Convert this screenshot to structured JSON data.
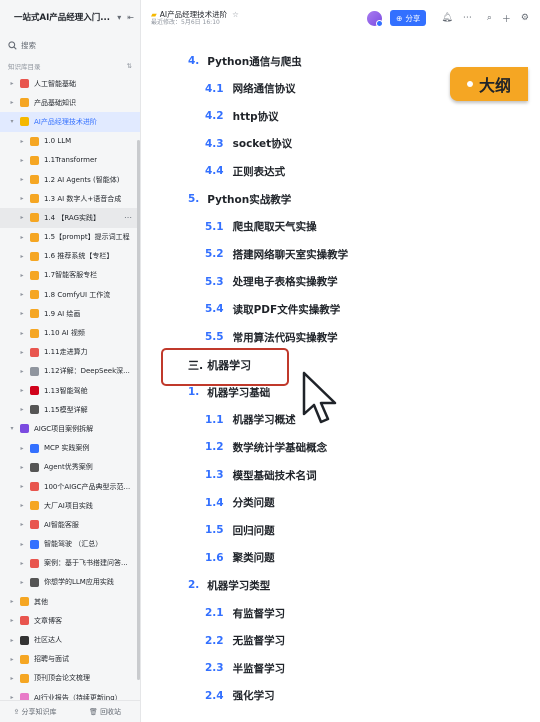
{
  "sidebar": {
    "title": "一站式AI产品经理入门...",
    "search_placeholder": "搜索",
    "section_label": "知识库目录",
    "items": [
      {
        "label": "人工智能基础",
        "depth": 0,
        "color": "#e8554e"
      },
      {
        "label": "产品基础知识",
        "depth": 0,
        "color": "#f5a623"
      },
      {
        "label": "AI产品经理技术进阶",
        "depth": 0,
        "color": "#f5b800",
        "selected": true,
        "open": true
      },
      {
        "label": "1.0 LLM",
        "depth": 1,
        "color": "#f5a623"
      },
      {
        "label": "1.1Transformer",
        "depth": 1,
        "color": "#f5a623"
      },
      {
        "label": "1.2 AI Agents (智能体)",
        "depth": 1,
        "color": "#f5a623"
      },
      {
        "label": "1.3 AI 数字人+语音合成",
        "depth": 1,
        "color": "#f5a623"
      },
      {
        "label": "1.4 【RAG实践】",
        "depth": 1,
        "color": "#f5a623",
        "hover": true
      },
      {
        "label": "1.5【prompt】提示词工程",
        "depth": 1,
        "color": "#f5a623"
      },
      {
        "label": "1.6 推荐系统【专栏】",
        "depth": 1,
        "color": "#f5a623"
      },
      {
        "label": "1.7智能客服专栏",
        "depth": 1,
        "color": "#f5a623"
      },
      {
        "label": "1.8 ComfyUI 工作流",
        "depth": 1,
        "color": "#f5a623"
      },
      {
        "label": "1.9 AI 绘画",
        "depth": 1,
        "color": "#f5a623"
      },
      {
        "label": "1.10 AI 视频",
        "depth": 1,
        "color": "#f5a623"
      },
      {
        "label": "1.11走进算力",
        "depth": 1,
        "color": "#e8554e"
      },
      {
        "label": "1.12详解：DeepSeek深...",
        "depth": 1,
        "color": "#8f959e"
      },
      {
        "label": "1.13智能驾舱",
        "depth": 1,
        "color": "#d0021b"
      },
      {
        "label": "1.15模型详解",
        "depth": 1,
        "color": "#555"
      },
      {
        "label": "AIGC项目案例拆解",
        "depth": 0,
        "color": "#7b4be0",
        "open": true
      },
      {
        "label": "MCP 实践案例",
        "depth": 1,
        "color": "#3370ff"
      },
      {
        "label": "Agent优秀案例",
        "depth": 1,
        "color": "#555"
      },
      {
        "label": "100个AIGC产品典型示范...",
        "depth": 1,
        "color": "#e8554e"
      },
      {
        "label": "大厂AI项目实践",
        "depth": 1,
        "color": "#f5a623"
      },
      {
        "label": "AI智能客服",
        "depth": 1,
        "color": "#e8554e"
      },
      {
        "label": "智能驾驶 （汇总）",
        "depth": 1,
        "color": "#3370ff"
      },
      {
        "label": "案例：基于飞书搭建问答...",
        "depth": 1,
        "color": "#e8554e"
      },
      {
        "label": "你想学的LLM应用实践",
        "depth": 1,
        "color": "#555"
      },
      {
        "label": "其他",
        "depth": 0,
        "color": "#f5a623"
      },
      {
        "label": "文章博客",
        "depth": 0,
        "color": "#e8554e"
      },
      {
        "label": "社区达人",
        "depth": 0,
        "color": "#333"
      },
      {
        "label": "招聘与面试",
        "depth": 0,
        "color": "#f5a623"
      },
      {
        "label": "顶刊顶会论文梳理",
        "depth": 0,
        "color": "#f5a623"
      },
      {
        "label": "AI行业报告（持续更新ing）",
        "depth": 0,
        "color": "#e87ac8"
      }
    ],
    "footer": {
      "share_label": "分享知识库",
      "trash_label": "回收站"
    }
  },
  "header": {
    "doc_title": "AI产品经理技术进阶",
    "subtitle": "最近修改：5月6日 16:10",
    "share_label": "分享"
  },
  "badge_label": "大纲",
  "outline": [
    {
      "num": "4.",
      "text": "Python通信与爬虫",
      "level": 1
    },
    {
      "num": "4.1",
      "text": "网络通信协议",
      "level": 2
    },
    {
      "num": "4.2",
      "text": "http协议",
      "level": 2
    },
    {
      "num": "4.3",
      "text": "socket协议",
      "level": 2
    },
    {
      "num": "4.4",
      "text": "正则表达式",
      "level": 2
    },
    {
      "num": "5.",
      "text": "Python实战教学",
      "level": 1
    },
    {
      "num": "5.1",
      "text": "爬虫爬取天气实操",
      "level": 2
    },
    {
      "num": "5.2",
      "text": "搭建网络聊天室实操教学",
      "level": 2
    },
    {
      "num": "5.3",
      "text": "处理电子表格实操教学",
      "level": 2
    },
    {
      "num": "5.4",
      "text": "读取PDF文件实操教学",
      "level": 2
    },
    {
      "num": "5.5",
      "text": "常用算法代码实操教学",
      "level": 2
    },
    {
      "num": "三.",
      "text": "机器学习",
      "level": 0
    },
    {
      "num": "1.",
      "text": "机器学习基础",
      "level": 1
    },
    {
      "num": "1.1",
      "text": "机器学习概述",
      "level": 2
    },
    {
      "num": "1.2",
      "text": "数学统计学基础概念",
      "level": 2
    },
    {
      "num": "1.3",
      "text": "模型基础技术名词",
      "level": 2
    },
    {
      "num": "1.4",
      "text": "分类问题",
      "level": 2
    },
    {
      "num": "1.5",
      "text": "回归问题",
      "level": 2
    },
    {
      "num": "1.6",
      "text": "聚类问题",
      "level": 2
    },
    {
      "num": "2.",
      "text": "机器学习类型",
      "level": 1
    },
    {
      "num": "2.1",
      "text": "有监督学习",
      "level": 2
    },
    {
      "num": "2.2",
      "text": "无监督学习",
      "level": 2
    },
    {
      "num": "2.3",
      "text": "半监督学习",
      "level": 2
    },
    {
      "num": "2.4",
      "text": "强化学习",
      "level": 2
    }
  ]
}
